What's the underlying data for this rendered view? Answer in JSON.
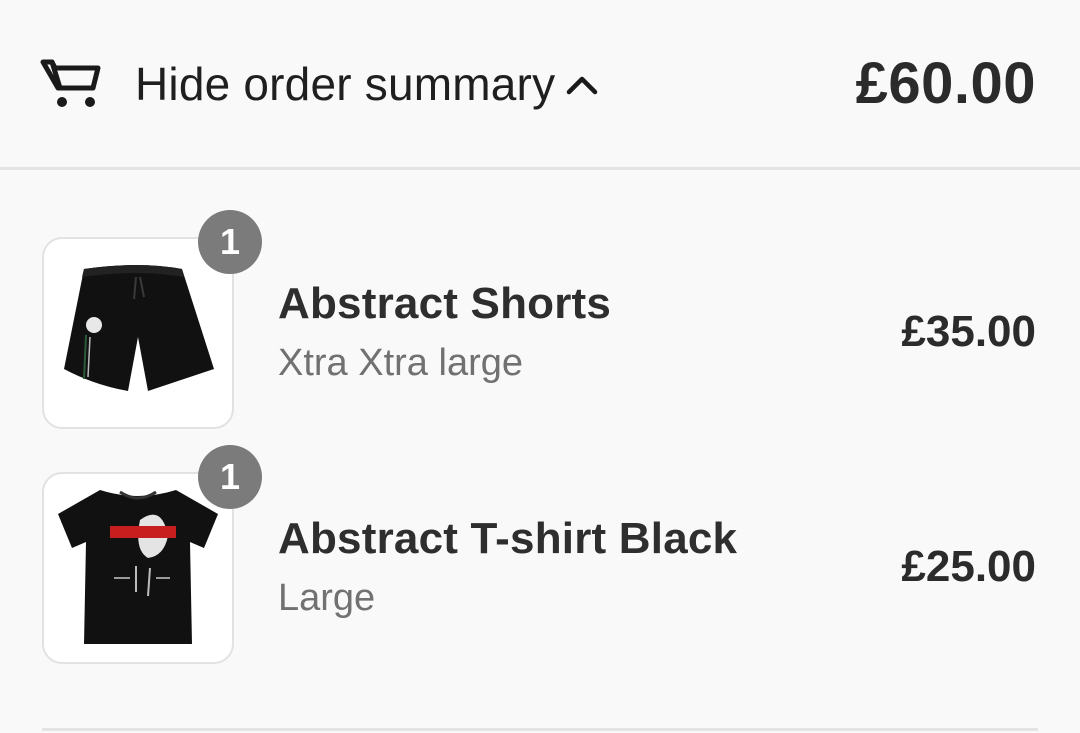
{
  "summary_toggle": {
    "label": "Hide order summary",
    "cart_icon": "cart-icon",
    "chevron_icon": "chevron-up-icon",
    "total": "£60.00"
  },
  "line_items": [
    {
      "name": "Abstract Shorts",
      "variant": "Xtra Xtra large",
      "price": "£35.00",
      "quantity": "1",
      "image_icon": "black-shorts-image"
    },
    {
      "name": "Abstract T-shirt Black",
      "variant": "Large",
      "price": "£25.00",
      "quantity": "1",
      "image_icon": "black-tshirt-image"
    }
  ],
  "colors": {
    "background": "#f9f9f9",
    "badge": "#7b7b7b",
    "divider": "#e3e3e3",
    "muted_text": "#717171"
  }
}
